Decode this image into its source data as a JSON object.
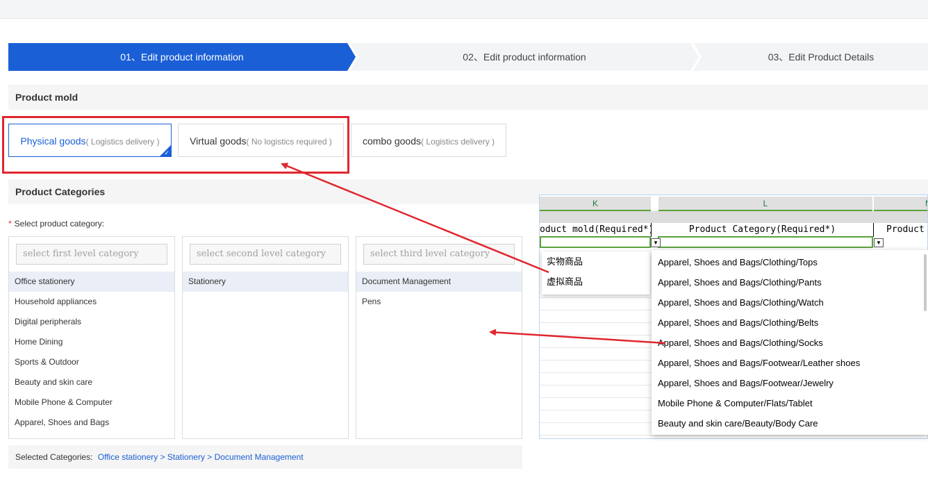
{
  "steps": [
    {
      "label": "01、Edit product information"
    },
    {
      "label": "02、Edit product information"
    },
    {
      "label": "03、Edit Product Details"
    }
  ],
  "sections": {
    "mold_title": "Product mold",
    "categories_title": "Product Categories"
  },
  "molds": [
    {
      "label": "Physical goods",
      "hint": "( Logistics delivery )"
    },
    {
      "label": "Virtual goods",
      "hint": "( No logistics required )"
    },
    {
      "label": "combo goods",
      "hint": "( Logistics delivery )"
    }
  ],
  "category": {
    "required_label": "Select product category:",
    "placeholders": {
      "first": "select first level category",
      "second": "select second level category",
      "third": "select third level category"
    },
    "first_level": [
      "Office stationery",
      "Household appliances",
      "Digital peripherals",
      "Home Dining",
      "Sports & Outdoor",
      "Beauty and skin care",
      "Mobile Phone & Computer",
      "Apparel, Shoes and Bags"
    ],
    "second_level": [
      "Stationery"
    ],
    "third_level": [
      "Document Management",
      "Pens"
    ],
    "selected_label": "Selected Categories:",
    "selected_path": "Office stationery >  Stationery >  Document Management"
  },
  "spreadsheet": {
    "columns": [
      "K",
      "L",
      "M"
    ],
    "headers": [
      "oduct mold(Required*)",
      "Product Category(Required*)",
      "Product"
    ],
    "mold_options": [
      "实物商品",
      "虚拟商品"
    ],
    "category_options": [
      "Apparel, Shoes and Bags/Clothing/Tops",
      "Apparel, Shoes and Bags/Clothing/Pants",
      "Apparel, Shoes and Bags/Clothing/Watch",
      "Apparel, Shoes and Bags/Clothing/Belts",
      "Apparel, Shoes and Bags/Clothing/Socks",
      "Apparel, Shoes and Bags/Footwear/Leather shoes",
      "Apparel, Shoes and Bags/Footwear/Jewelry",
      "Mobile Phone & Computer/Flats/Tablet",
      "Beauty and skin care/Beauty/Body Care"
    ]
  },
  "colors": {
    "accent": "#1a5fd6",
    "highlight_red": "#e0262f",
    "excel_green": "#5aa23b"
  }
}
